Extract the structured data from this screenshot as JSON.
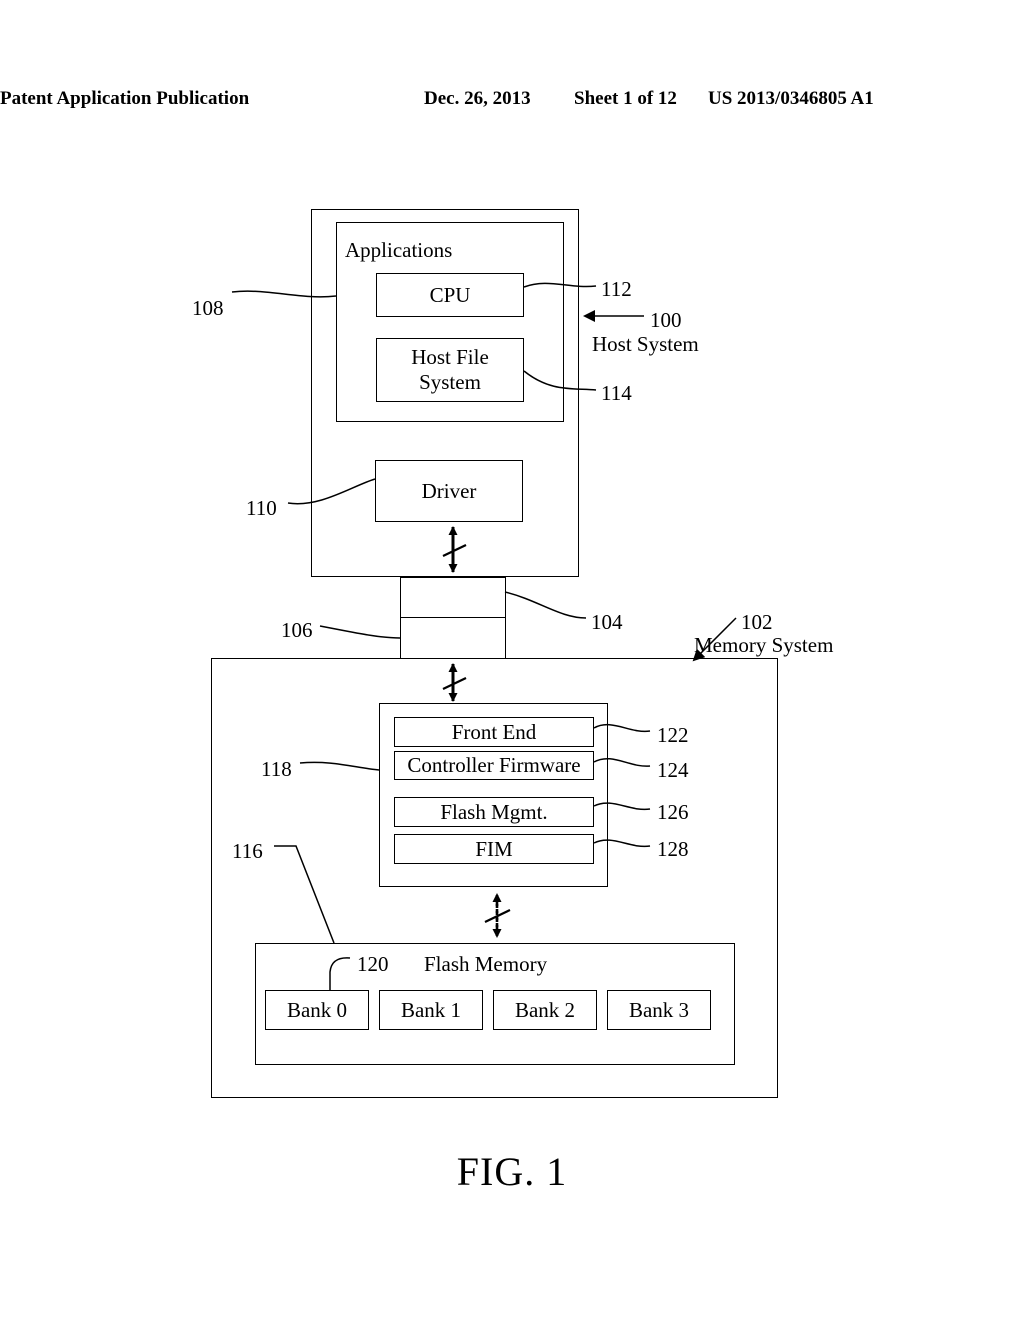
{
  "header": {
    "publication": "Patent Application Publication",
    "date": "Dec. 26, 2013",
    "sheet": "Sheet 1 of 12",
    "patent_number": "US 2013/0346805 A1"
  },
  "figure": {
    "caption": "FIG. 1"
  },
  "diagram": {
    "host_system": {
      "ref": "100",
      "label": "Host System",
      "applications": {
        "ref": "108",
        "label": "Applications",
        "cpu": {
          "ref": "112",
          "label": "CPU"
        },
        "host_file_system": {
          "ref": "114",
          "label": "Host File System"
        }
      },
      "driver": {
        "ref": "110",
        "label": "Driver"
      }
    },
    "connector": {
      "upper": {
        "ref": "104"
      },
      "lower": {
        "ref": "106"
      }
    },
    "memory_system": {
      "ref": "102",
      "label": "Memory System",
      "controller": {
        "ref": "118",
        "modules": [
          {
            "ref": "122",
            "label": "Front End"
          },
          {
            "ref": "124",
            "label": "Controller Firmware"
          },
          {
            "ref": "126",
            "label": "Flash Mgmt."
          },
          {
            "ref": "128",
            "label": "FIM"
          }
        ]
      },
      "flash_memory": {
        "ref": "116",
        "label": "Flash Memory",
        "bank_ref": "120",
        "banks": [
          {
            "label": "Bank 0"
          },
          {
            "label": "Bank 1"
          },
          {
            "label": "Bank 2"
          },
          {
            "label": "Bank 3"
          }
        ]
      }
    }
  }
}
